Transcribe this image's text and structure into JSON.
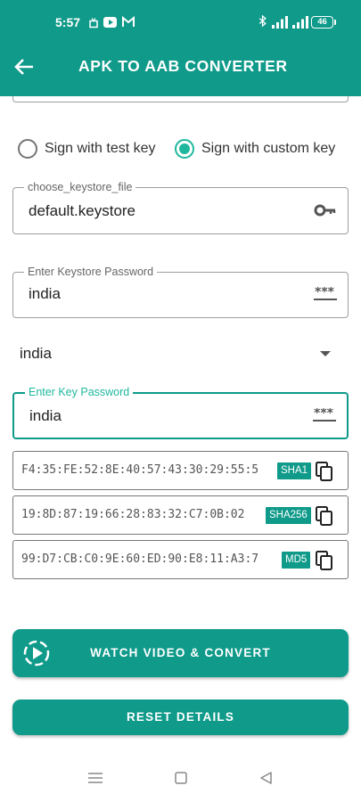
{
  "status_bar": {
    "time": "5:57",
    "battery": "46",
    "left_icons": [
      "cast-icon",
      "youtube-icon",
      "gmail-icon"
    ],
    "right_icons": [
      "bluetooth-icon",
      "signal-icon",
      "signal-icon",
      "battery-icon"
    ]
  },
  "header": {
    "title": "APK TO AAB CONVERTER",
    "back_icon": "arrow-back-icon",
    "color": "#0f9a8a"
  },
  "signing": {
    "options": [
      {
        "label": "Sign with test key",
        "selected": false
      },
      {
        "label": "Sign with custom key",
        "selected": true
      }
    ],
    "accent": "#1fb89f"
  },
  "keystore_field": {
    "label": "choose_keystore_file",
    "value": "default.keystore",
    "icon": "key-icon"
  },
  "keystore_password": {
    "label": "Enter Keystore Password",
    "value": "india",
    "icon": "password-icon"
  },
  "alias_select": {
    "value": "india"
  },
  "key_password": {
    "label": "Enter Key Password",
    "value": "india",
    "icon": "password-icon"
  },
  "hashes": [
    {
      "value": "F4:35:FE:52:8E:40:57:43:30:29:55:5",
      "badge": "SHA1"
    },
    {
      "value": "19:8D:87:19:66:28:83:32:C7:0B:02",
      "badge": "SHA256"
    },
    {
      "value": "99:D7:CB:C0:9E:60:ED:90:E8:11:A3:7",
      "badge": "MD5"
    }
  ],
  "buttons": {
    "watch_convert": "WATCH VIDEO & CONVERT",
    "reset": "RESET DETAILS"
  },
  "nav_bar": [
    "menu-icon",
    "home-icon",
    "back-triangle-icon"
  ]
}
